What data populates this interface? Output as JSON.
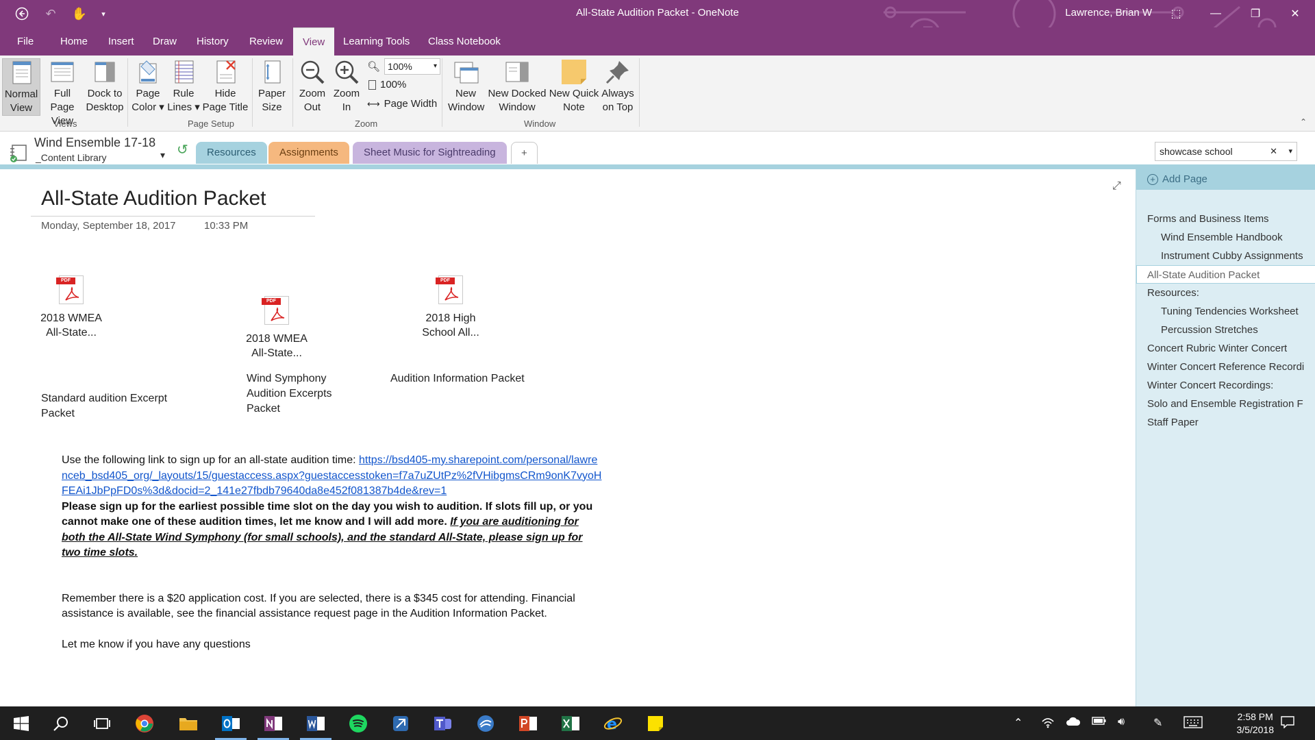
{
  "window": {
    "title": "All-State Audition Packet  -  OneNote",
    "user": "Lawrence, Brian W"
  },
  "menu": {
    "tabs": [
      "File",
      "Home",
      "Insert",
      "Draw",
      "History",
      "Review",
      "View",
      "Learning Tools",
      "Class Notebook"
    ],
    "active": "View"
  },
  "ribbon": {
    "views": {
      "normal_line1": "Normal",
      "normal_line2": "View",
      "full_line1": "Full Page",
      "full_line2": "View",
      "dock_line1": "Dock to",
      "dock_line2": "Desktop",
      "group": "Views"
    },
    "page_setup": {
      "color_line1": "Page",
      "color_line2": "Color ▾",
      "rule_line1": "Rule",
      "rule_line2": "Lines ▾",
      "hide_line1": "Hide",
      "hide_line2": "Page Title",
      "paper_line1": "Paper",
      "paper_line2": "Size",
      "group": "Page Setup"
    },
    "zoom": {
      "out_line1": "Zoom",
      "out_line2": "Out",
      "in_line1": "Zoom",
      "in_line2": "In",
      "combo_value": "100%",
      "hundred": "100%",
      "page_width": "Page Width",
      "group": "Zoom"
    },
    "window": {
      "new_line1": "New",
      "new_line2": "Window",
      "docked_line1": "New Docked",
      "docked_line2": "Window",
      "quick_line1": "New Quick",
      "quick_line2": "Note",
      "top_line1": "Always",
      "top_line2": "on Top",
      "group": "Window"
    }
  },
  "notebook": {
    "name": "Wind Ensemble 17-18",
    "section_group": "_Content Library",
    "sections": [
      "Resources",
      "Assignments",
      "Sheet Music for Sightreading"
    ],
    "add_section": "+",
    "colors": {
      "resources": "#a6d2df",
      "assignments": "#f5b87f",
      "sheet_music": "#c8b5de"
    }
  },
  "search": {
    "value": "showcase school"
  },
  "page": {
    "title": "All-State Audition Packet",
    "date": "Monday, September 18, 2017",
    "time": "10:33 PM",
    "files": [
      {
        "line1": "2018 WMEA",
        "line2": "All-State..."
      },
      {
        "line1": "2018 WMEA",
        "line2": "All-State..."
      },
      {
        "line1": "2018 High",
        "line2": "School All..."
      }
    ],
    "captions": [
      "Standard audition Excerpt Packet",
      "Wind Symphony Audition Excerpts Packet",
      "Audition Information Packet"
    ],
    "signup_intro": "Use the following link to sign up for an all-state audition time: ",
    "signup_link": "https://bsd405-my.sharepoint.com/personal/lawrenceb_bsd405_org/_layouts/15/guestaccess.aspx?guestaccesstoken=f7a7uZUtPz%2fVHibgmsCRm9onK7vyoHFEAi1JbPpFD0s%3d&docid=2_141e27fbdb79640da8e452f081387b4de&rev=1",
    "bold_text": "Please sign up for the earliest possible time slot on the day you wish to audition. If slots fill up, or you cannot make one of these audition times, let me know and I will add more. ",
    "bold_italic_text": "If you are auditioning for both the All-State Wind Symphony (for small schools), and the standard All-State, please sign up for two time slots.",
    "cost_text": "Remember there is a $20 application cost. If you are selected, there is a $345 cost for attending. Financial assistance is available, see the financial assistance request page in the Audition Information Packet.",
    "closing": "Let me know if you have any questions"
  },
  "page_list": {
    "add_page": "Add Page",
    "items": [
      {
        "label": "Forms and Business Items",
        "indent": 0
      },
      {
        "label": "Wind Ensemble Handbook",
        "indent": 1
      },
      {
        "label": "Instrument Cubby Assignments",
        "indent": 1
      },
      {
        "label": "All-State Audition Packet",
        "indent": 0,
        "selected": true
      },
      {
        "label": "Resources:",
        "indent": 0
      },
      {
        "label": "Tuning Tendencies Worksheet",
        "indent": 1
      },
      {
        "label": "Percussion Stretches",
        "indent": 1
      },
      {
        "label": "Concert Rubric Winter Concert",
        "indent": 0
      },
      {
        "label": "Winter Concert Reference Recordi",
        "indent": 0
      },
      {
        "label": "Winter Concert Recordings:",
        "indent": 0
      },
      {
        "label": "Solo and Ensemble Registration F",
        "indent": 0
      },
      {
        "label": "Staff Paper",
        "indent": 0
      }
    ]
  },
  "taskbar": {
    "apps": [
      "start-icon",
      "search-icon",
      "task-view-icon",
      "chrome-icon",
      "file-explorer-icon",
      "outlook-icon",
      "onenote-icon",
      "word-icon",
      "spotify-icon",
      "app-icon",
      "teams-icon",
      "app-icon",
      "powerpoint-icon",
      "excel-icon",
      "internet-explorer-icon",
      "sticky-notes-icon"
    ],
    "time": "2:58 PM",
    "date": "3/5/2018"
  }
}
